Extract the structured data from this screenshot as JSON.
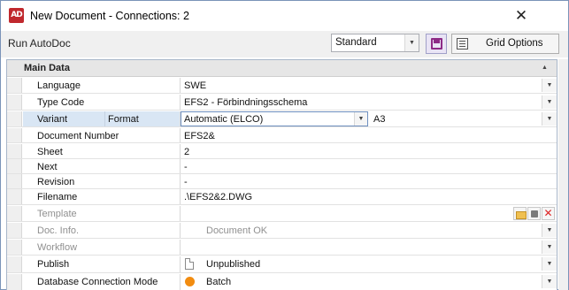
{
  "window": {
    "title": "New Document - Connections: 2",
    "app_icon_text": "AD"
  },
  "toolbar": {
    "run_autodoc_label": "Run AutoDoc",
    "style_value": "Standard",
    "grid_options_label": "Grid Options"
  },
  "section": {
    "title": "Main Data"
  },
  "rows": {
    "language": {
      "label": "Language",
      "value": "SWE"
    },
    "type_code": {
      "label": "Type Code",
      "value": "EFS2 - Förbindningsschema"
    },
    "variant": {
      "label": "Variant",
      "format_label": "Format",
      "value": "Automatic (ELCO)",
      "format_value": "A3"
    },
    "document_number": {
      "label": "Document Number",
      "value": "EFS2&"
    },
    "sheet": {
      "label": "Sheet",
      "value": "2"
    },
    "next": {
      "label": "Next",
      "value": "-"
    },
    "revision": {
      "label": "Revision",
      "value": "-"
    },
    "filename": {
      "label": "Filename",
      "value": ".\\EFS2&2.DWG"
    },
    "template": {
      "label": "Template",
      "value": ""
    },
    "doc_info": {
      "label": "Doc. Info.",
      "value": "Document OK"
    },
    "workflow": {
      "label": "Workflow",
      "value": ""
    },
    "publish": {
      "label": "Publish",
      "value": "Unpublished"
    },
    "db_connection_mode": {
      "label": "Database Connection Mode",
      "value": "Batch"
    }
  },
  "colors": {
    "window_border": "#7a93b8",
    "selected_row": "#d9e6f4",
    "save_icon": "#8d2a86",
    "delete_icon": "#dd2222",
    "batch_icon": "#f28c10",
    "app_icon": "#c0282d"
  },
  "icons": {
    "close": "close-icon",
    "save": "save-icon",
    "grid_options": "grid-options-icon",
    "template_browse": "folder-icon",
    "template_clear": "clear-icon",
    "template_delete": "delete-icon",
    "publish_state": "document-icon",
    "connection_mode": "batch-icon"
  }
}
